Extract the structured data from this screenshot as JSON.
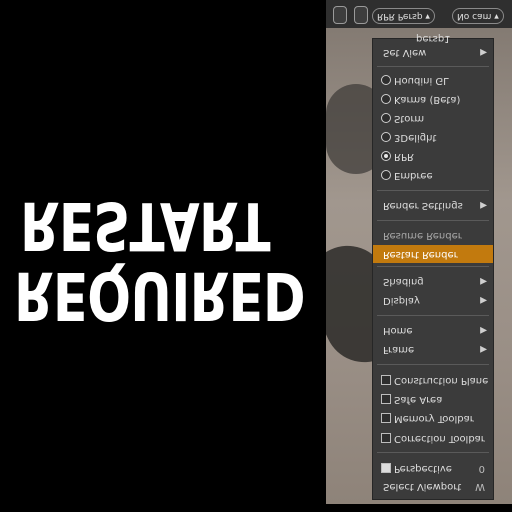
{
  "headline": {
    "line1": "REQUIRED",
    "line2": "RESTART"
  },
  "menu": {
    "items": [
      {
        "label": "Select Viewport",
        "hotkey": "W"
      },
      {
        "label": "Perspective",
        "hotkey": "0"
      },
      {
        "label": "Correction Toolbar"
      },
      {
        "label": "Memory Toolbar"
      },
      {
        "label": "Safe Area"
      },
      {
        "label": "Construction Plane"
      },
      {
        "label": "Frame"
      },
      {
        "label": "Home"
      },
      {
        "label": "Display"
      },
      {
        "label": "Shading"
      },
      {
        "label": "Restart Render"
      },
      {
        "label": "Resume Render"
      },
      {
        "label": "Render Settings"
      },
      {
        "label": "Embree"
      },
      {
        "label": "RPR"
      },
      {
        "label": "3Delight"
      },
      {
        "label": "Storm"
      },
      {
        "label": "Karma (Beta)"
      },
      {
        "label": "Houdini GL"
      },
      {
        "label": "Set View"
      }
    ],
    "selected_renderer": "RPR",
    "highlighted_item": "Restart Render"
  },
  "viewport": {
    "view_name": "persp1"
  },
  "toolbar": {
    "persp_label": "RPR Persp",
    "cam_label": "No cam"
  },
  "colors": {
    "highlight": "#c27a0e",
    "menu_bg": "#3b3b3b"
  }
}
